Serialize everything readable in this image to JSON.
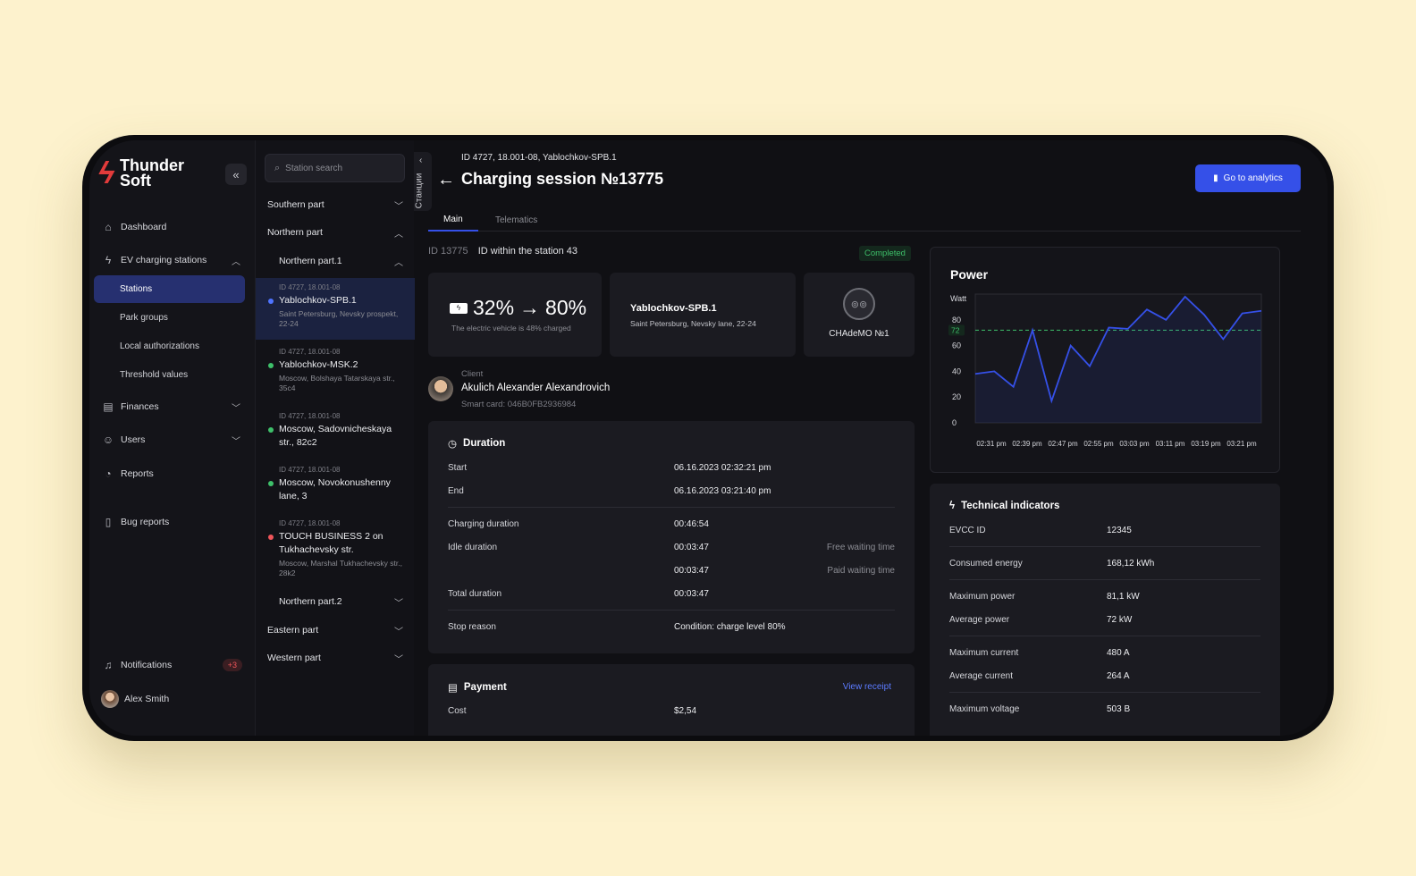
{
  "sidebar": {
    "logo": {
      "line1": "Thunder",
      "line2": "Soft"
    },
    "collapse_icon": "«",
    "items": [
      {
        "label": "Dashboard",
        "icon": "home-icon"
      },
      {
        "label": "EV charging stations",
        "icon": "lightning-icon"
      },
      {
        "label": "Finances",
        "icon": "receipt-icon"
      },
      {
        "label": "Users",
        "icon": "users-icon"
      },
      {
        "label": "Reports",
        "icon": "chart-pie-icon"
      },
      {
        "label": "Bug reports",
        "icon": "file-icon"
      }
    ],
    "sub_items": [
      "Stations",
      "Park groups",
      "Local authorizations",
      "Threshold values"
    ],
    "notifications": {
      "label": "Notifications",
      "badge": "+3"
    },
    "user": {
      "name": "Alex Smith"
    }
  },
  "stations": {
    "search_placeholder": "Station search",
    "groups": {
      "southern": "Southern part",
      "northern": "Northern part",
      "northern1": "Northern part.1",
      "northern2": "Northern part.2",
      "eastern": "Eastern part",
      "western": "Western part"
    },
    "items": [
      {
        "id": "ID 4727, 18.001-08",
        "name": "Yablochkov-SPB.1",
        "addr": "Saint Petersburg, Nevsky prospekt, 22-24",
        "status_color": "#4f74ff"
      },
      {
        "id": "ID 4727, 18.001-08",
        "name": "Yablochkov-MSK.2",
        "addr": "Moscow, Bolshaya Tatarskaya str., 35c4",
        "status_color": "#3ec06a"
      },
      {
        "id": "ID 4727, 18.001-08",
        "name": "Moscow, Sadovnicheskaya str., 82c2",
        "addr": "",
        "status_color": "#3ec06a"
      },
      {
        "id": "ID 4727, 18.001-08",
        "name": "Moscow, Novokonushenny lane, 3",
        "addr": "",
        "status_color": "#3ec06a"
      },
      {
        "id": "ID 4727, 18.001-08",
        "name": "TOUCH BUSINESS 2 on Tukhachevsky str.",
        "addr": "Moscow, Marshal Tukhachevsky str., 28k2",
        "status_color": "#f0555a"
      }
    ],
    "side_tab": "Станции"
  },
  "header": {
    "breadcrumb": "ID 4727, 18.001-08, Yablochkov-SPB.1",
    "title": "Charging session №13775",
    "analytics_button": "Go to analytics",
    "tabs": [
      "Main",
      "Telematics"
    ]
  },
  "session": {
    "id": "ID 13775",
    "station_id": "ID within the station 43",
    "status": "Completed",
    "charge_from": "32%",
    "charge_to": "80%",
    "charge_note": "The electric vehicle is 48% charged",
    "station_name": "Yablochkov-SPB.1",
    "station_addr": "Saint Petersburg, Nevsky lane, 22-24",
    "connector": "CHAdeMO №1"
  },
  "client": {
    "label": "Client",
    "name": "Akulich Alexander Alexandrovich",
    "card": "Smart card: 046B0FB2936984"
  },
  "duration": {
    "title": "Duration",
    "start_label": "Start",
    "start": "06.16.2023 02:32:21 pm",
    "end_label": "End",
    "end": "06.16.2023 03:21:40 pm",
    "charging_label": "Charging duration",
    "charging": "00:46:54",
    "idle_label": "Idle duration",
    "idle_free": "00:03:47",
    "free_note": "Free waiting time",
    "idle_paid": "00:03:47",
    "paid_note": "Paid waiting time",
    "total_label": "Total duration",
    "total": "00:03:47",
    "stop_label": "Stop reason",
    "stop": "Condition: charge level 80%"
  },
  "payment": {
    "title": "Payment",
    "receipt": "View receipt",
    "cost_label": "Cost",
    "cost": "$2,54"
  },
  "tech": {
    "title": "Technical indicators",
    "rows": [
      {
        "label": "EVCC ID",
        "value": "12345"
      },
      {
        "label": "Consumed energy",
        "value": "168,12 kWh"
      },
      {
        "label": "Maximum power",
        "value": "81,1 kW"
      },
      {
        "label": "Average power",
        "value": "72 kW"
      },
      {
        "label": "Maximum current",
        "value": "480 A"
      },
      {
        "label": "Average current",
        "value": "264 A"
      },
      {
        "label": "Maximum voltage",
        "value": "503 B"
      }
    ]
  },
  "chart_data": {
    "type": "line",
    "title": "Power",
    "ylabel": "Watt",
    "ylim": [
      0,
      100
    ],
    "yticks": [
      0,
      20,
      40,
      60,
      80
    ],
    "reference": {
      "value": 72,
      "label": "72",
      "color": "#3ec06a"
    },
    "x_tick_labels": [
      "02:31 pm",
      "02:39 pm",
      "02:47 pm",
      "02:55 pm",
      "03:03 pm",
      "03:11 pm",
      "03:19 pm",
      "03:21 pm"
    ],
    "series": [
      {
        "color": "#3550e8",
        "values": [
          38,
          40,
          28,
          72,
          17,
          60,
          44,
          74,
          73,
          88,
          80,
          98,
          84,
          65,
          85,
          87
        ]
      }
    ]
  }
}
